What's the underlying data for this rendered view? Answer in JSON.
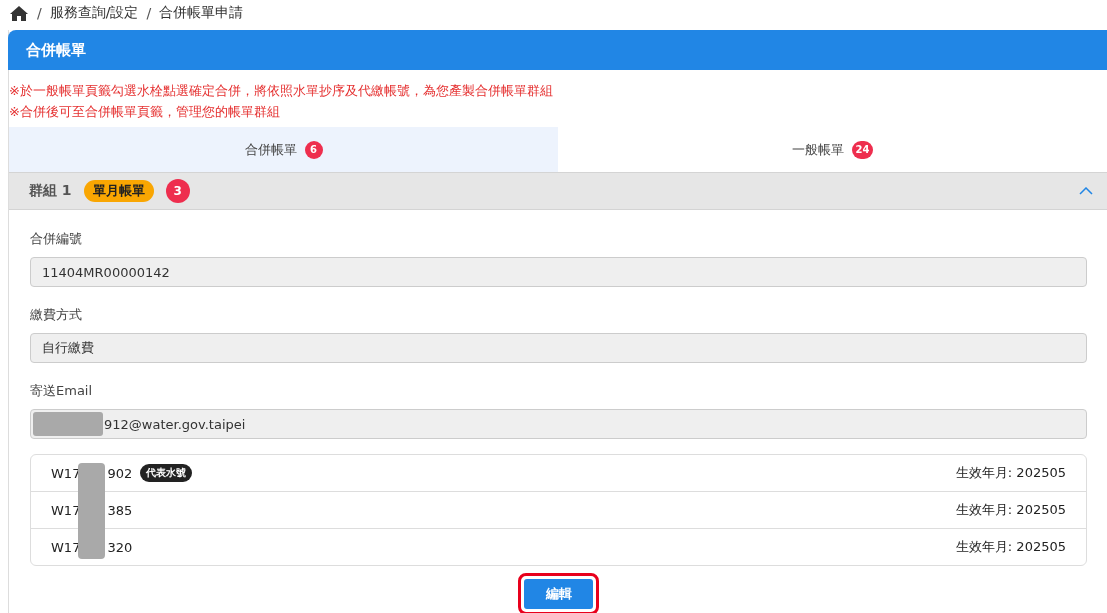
{
  "breadcrumb": [
    {
      "separator": "/",
      "label": "服務查詢/設定"
    },
    {
      "separator": "/",
      "label": "合併帳單申請"
    }
  ],
  "card": {
    "title": "合併帳單"
  },
  "notes": [
    "※於一般帳單頁籤勾選水栓點選確定合併，將依照水單抄序及代繳帳號，為您產製合併帳單群組",
    "※合併後可至合併帳單頁籤，管理您的帳單群組"
  ],
  "tabs": [
    {
      "label": "合併帳單",
      "count": "6",
      "selected": true
    },
    {
      "label": "一般帳單",
      "count": "24",
      "selected": false
    }
  ],
  "group": {
    "title": "群組 1",
    "tag": "單月帳單",
    "count": "3",
    "expanded": true,
    "fields": [
      {
        "label": "合併編號",
        "value": "11404MR00000142",
        "redacted": false
      },
      {
        "label": "繳費方式",
        "value": "自行繳費",
        "redacted": false
      },
      {
        "label": "寄送Email",
        "value": "912@water.gov.taipei",
        "redacted": true
      }
    ],
    "accounts": [
      {
        "prefix": "W17",
        "suffix": "902",
        "badge": "代表水號",
        "effective": "生效年月: 202505"
      },
      {
        "prefix": "W17",
        "suffix": "385",
        "effective": "生效年月: 202505"
      },
      {
        "prefix": "W17",
        "suffix": "320",
        "effective": "生效年月: 202505"
      }
    ],
    "accounts_redacted": true,
    "button": {
      "label": "編輯",
      "highlighted": true
    }
  }
}
